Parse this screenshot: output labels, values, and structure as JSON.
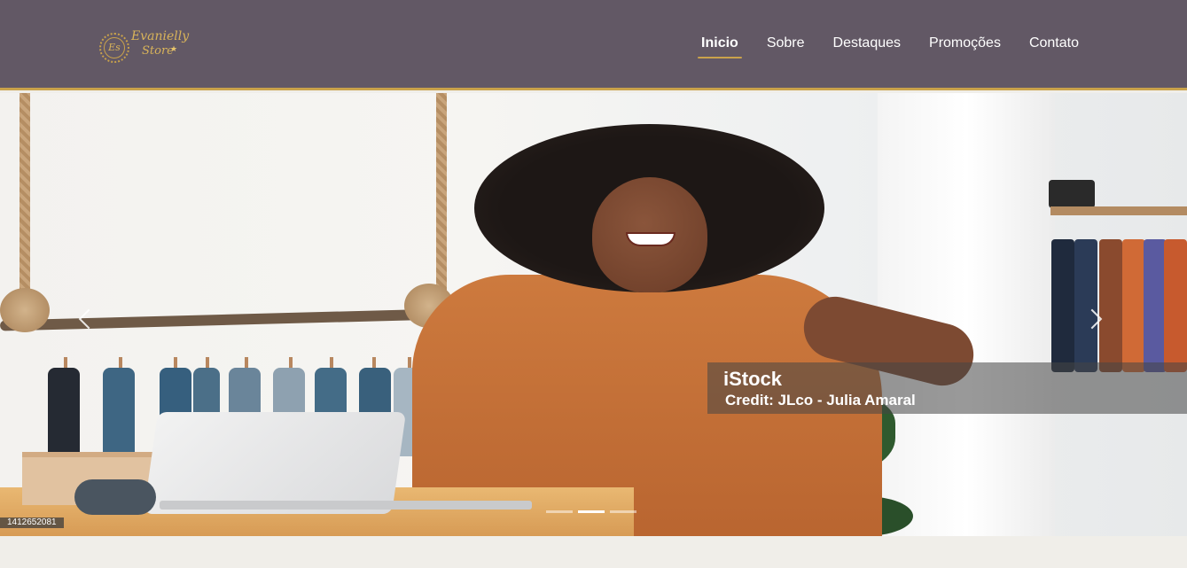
{
  "header": {
    "logo": {
      "monogram": "Es",
      "line1": "Evanielly",
      "line2": "Store"
    },
    "nav": [
      {
        "label": "Inicio",
        "active": true
      },
      {
        "label": "Sobre",
        "active": false
      },
      {
        "label": "Destaques",
        "active": false
      },
      {
        "label": "Promoções",
        "active": false
      },
      {
        "label": "Contato",
        "active": false
      }
    ],
    "accent_color": "#c9a24b",
    "background_color": "#625865"
  },
  "hero": {
    "watermark": {
      "brand": "iStock",
      "credit": "Credit: JLco - Julia Amaral",
      "image_id": "1412652081"
    },
    "prev_icon": "chevron-left-icon",
    "next_icon": "chevron-right-icon",
    "slides_count": 3,
    "active_slide": 2
  },
  "footer_background": "#f0eee9"
}
